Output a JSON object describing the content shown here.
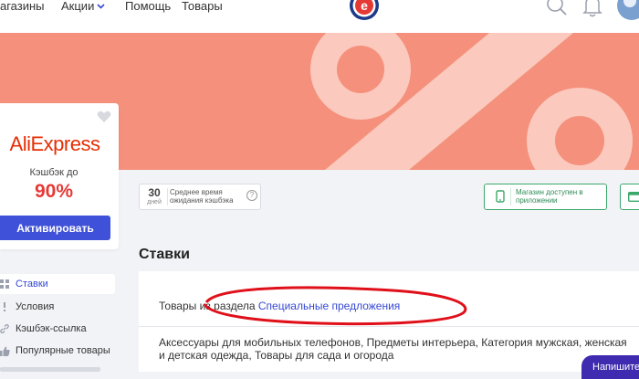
{
  "header": {
    "nav": [
      "агазины",
      "Акции",
      "Помощь",
      "Товары"
    ]
  },
  "store": {
    "brand": "AliExpress",
    "cashback_label": "Кэшбэк до",
    "cashback_value": "90%",
    "activate_label": "Активировать"
  },
  "menu": {
    "items": [
      {
        "label": "Ставки",
        "icon": "grid-icon"
      },
      {
        "label": "Условия",
        "icon": "exclamation-icon"
      },
      {
        "label": "Кэшбэк-ссылка",
        "icon": "link-icon"
      },
      {
        "label": "Популярные товары",
        "icon": "thumbs-up-icon"
      }
    ]
  },
  "info": {
    "days_number": "30",
    "days_label": "дней",
    "wait_label": "Среднее время ожидания кэшбэка",
    "app_label": "Магазин доступен в приложении"
  },
  "main": {
    "section_title": "Ставки",
    "row1_prefix": "Товары из раздела ",
    "row1_link": "Специальные предложения",
    "row2_text": "Аксессуары для мобильных телефонов, Предметы интерьера, Категория мужская, женская и детская одежда, Товары для сада и огорода"
  },
  "chat": {
    "write_label": "Напишите"
  },
  "colors": {
    "banner": "#f4907c",
    "accent": "#3f51d8",
    "annotation": "#e0101a",
    "aliexpress": "#e62e04"
  }
}
